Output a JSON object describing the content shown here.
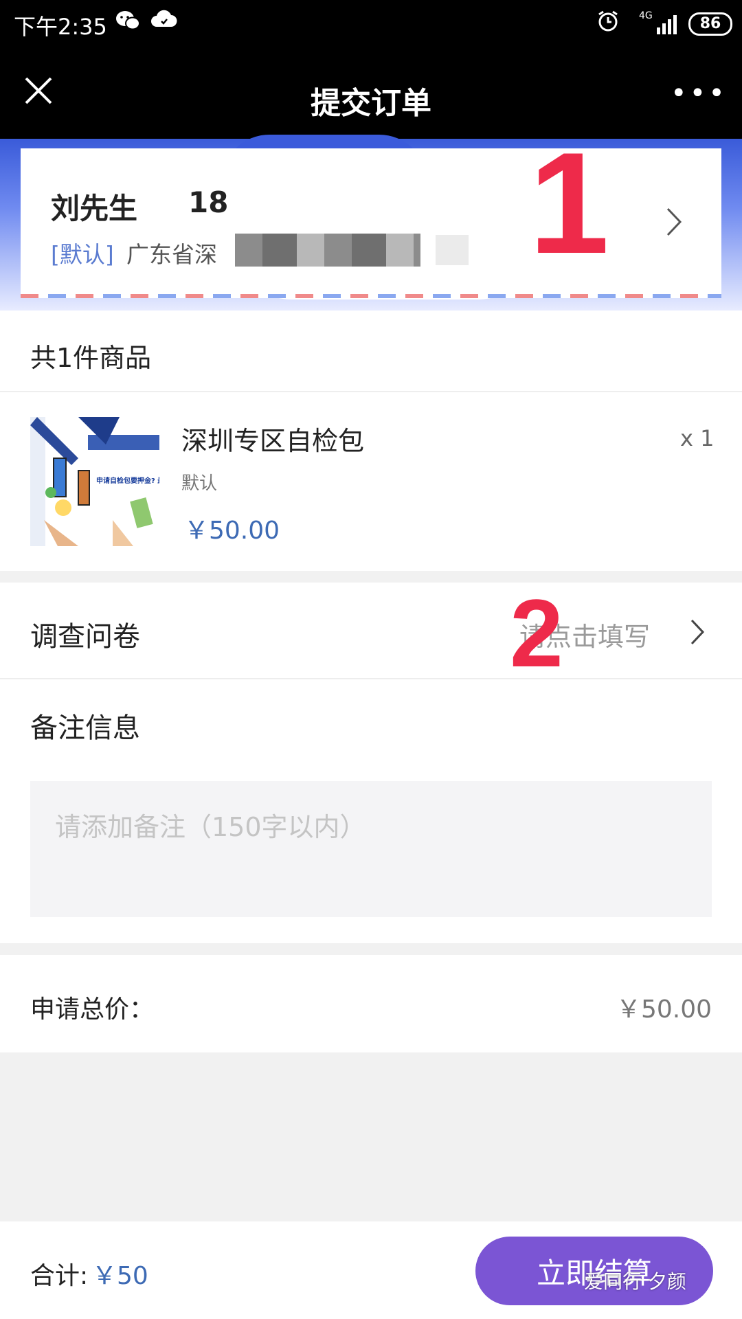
{
  "status_bar": {
    "time": "下午2:35",
    "battery": "86",
    "network": "4G",
    "icons": [
      "wechat-icon",
      "cloud-icon",
      "alarm-icon",
      "signal-icon",
      "battery-icon"
    ]
  },
  "nav": {
    "title": "提交订单",
    "close_icon": "close-icon",
    "more_label": "•••"
  },
  "address": {
    "name": "刘先生",
    "phone_visible": "18",
    "tag": "[默认]",
    "address_visible": "广东省深"
  },
  "annotations": {
    "one": "1",
    "two": "2"
  },
  "order": {
    "count_label": "共1件商品",
    "product": {
      "name": "深圳专区自检包",
      "spec": "默认",
      "price": "￥50.00",
      "qty": "x 1",
      "thumb_banner_text": "申请自检包要押金? 最快结果时间是!"
    }
  },
  "survey": {
    "label": "调查问卷",
    "placeholder": "请点击填写"
  },
  "remark": {
    "label": "备注信息",
    "placeholder": "请添加备注（150字以内）"
  },
  "total": {
    "label": "申请总价：",
    "value": "￥50.00"
  },
  "bottom": {
    "sum_label": "合计:",
    "sum_value": "￥50",
    "checkout_label": "立即结算",
    "watermark": "爱同行 夕颜"
  },
  "colors": {
    "accent_blue": "#3d6ab4",
    "checkout_purple": "#7b55d4",
    "annotation_red": "#ee2a4a"
  }
}
